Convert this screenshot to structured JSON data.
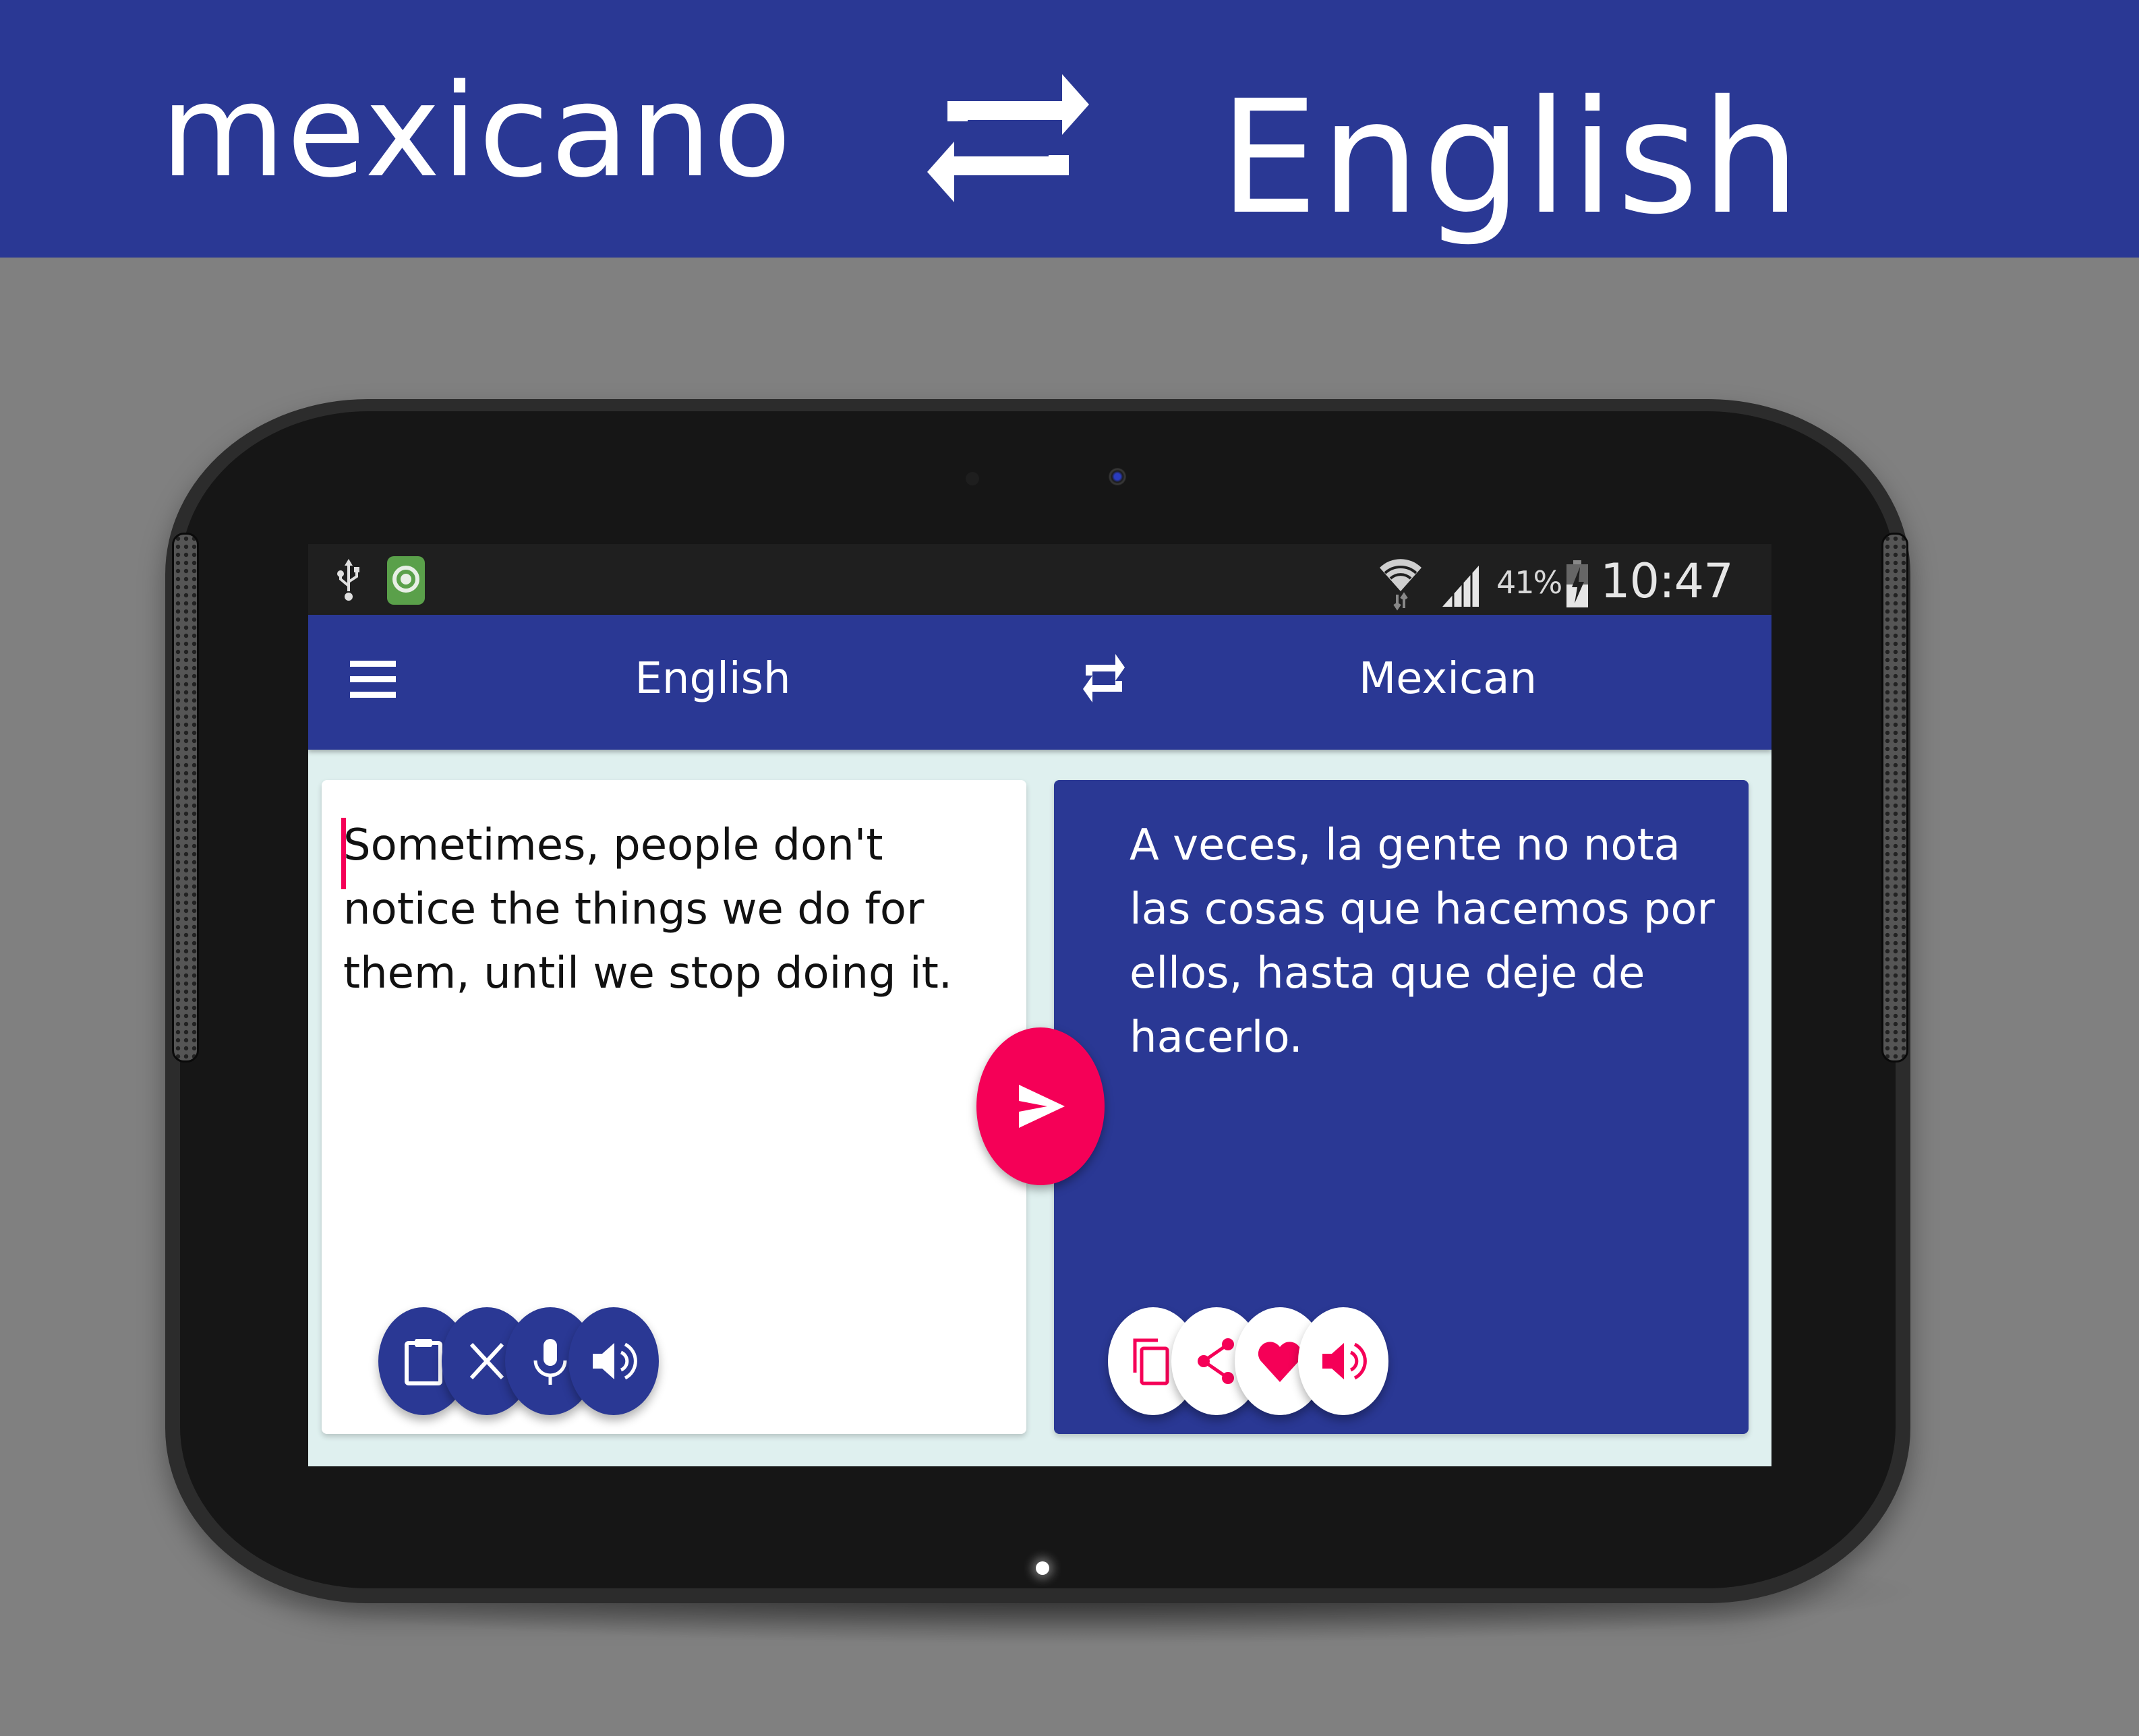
{
  "banner": {
    "source_language": "mexicano",
    "target_language": "English",
    "swap_icon": "swap-arrows-icon",
    "background_color": "#2a3894"
  },
  "status_bar": {
    "left_icons": [
      "usb-icon",
      "app-notification-icon"
    ],
    "wifi_icon": "wifi-icon",
    "signal_icon": "cell-signal-icon",
    "battery_percent": "41%",
    "battery_icon": "battery-charging-icon",
    "time": "10:47 AM"
  },
  "app_bar": {
    "menu_icon": "hamburger-menu-icon",
    "source_language": "English",
    "target_language": "Mexican",
    "swap_icon": "swap-arrows-icon",
    "color": "#2a3894"
  },
  "input_card": {
    "text": "Sometimes, people don't notice the things we do for them, until we stop doing it.",
    "buttons": [
      {
        "name": "paste",
        "icon": "clipboard-icon"
      },
      {
        "name": "clear",
        "icon": "close-icon"
      },
      {
        "name": "voice-input",
        "icon": "microphone-icon"
      },
      {
        "name": "speak",
        "icon": "speaker-icon"
      }
    ]
  },
  "translate_button": {
    "icon": "send-icon",
    "color": "#f50057"
  },
  "output_card": {
    "text": "A veces, la gente no nota las cosas que hacemos por ellos, hasta que deje de hacerlo.",
    "buttons": [
      {
        "name": "copy",
        "icon": "copy-icon"
      },
      {
        "name": "share",
        "icon": "share-icon"
      },
      {
        "name": "favorite",
        "icon": "heart-icon"
      },
      {
        "name": "speak",
        "icon": "speaker-icon"
      }
    ]
  },
  "colors": {
    "primary": "#2a3894",
    "accent": "#f50057",
    "content_background": "#dff0ef",
    "page_background": "#808080"
  }
}
